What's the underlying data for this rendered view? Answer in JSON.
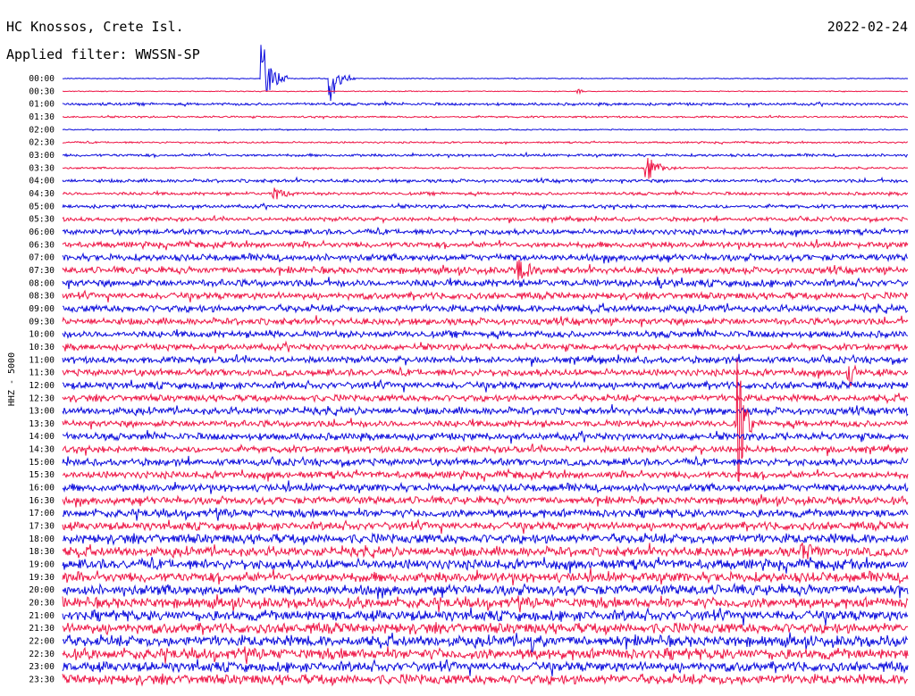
{
  "header": {
    "station": "HC Knossos, Crete Isl.",
    "filter": "Applied filter: WWSSN-SP",
    "date": "2022-02-24"
  },
  "chart_data": {
    "type": "line",
    "title": "HC Knossos, Crete Isl.",
    "subtitle": "Applied filter: WWSSN-SP",
    "date": "2022-02-24",
    "ylabel": "HHZ - 5000",
    "row_labels": [
      "00:00",
      "00:30",
      "01:00",
      "01:30",
      "02:00",
      "02:30",
      "03:00",
      "03:30",
      "04:00",
      "04:30",
      "05:00",
      "05:30",
      "06:00",
      "06:30",
      "07:00",
      "07:30",
      "08:00",
      "08:30",
      "09:00",
      "09:30",
      "10:00",
      "10:30",
      "11:00",
      "11:30",
      "12:00",
      "12:30",
      "13:00",
      "13:30",
      "14:00",
      "14:30",
      "15:00",
      "15:30",
      "16:00",
      "16:30",
      "17:00",
      "17:30",
      "18:00",
      "18:30",
      "19:00",
      "19:30",
      "20:00",
      "20:30",
      "21:00",
      "21:30",
      "22:00",
      "22:30",
      "23:00",
      "23:30"
    ],
    "trace_colors": [
      "#0b0bdc",
      "#ee1646"
    ],
    "noise_level": [
      0.4,
      0.4,
      1.2,
      0.8,
      0.5,
      0.8,
      1.2,
      0.8,
      1.5,
      1.4,
      1.6,
      1.8,
      2.4,
      2.6,
      3.0,
      3.0,
      3.2,
      3.0,
      3.2,
      3.0,
      3.0,
      2.8,
      3.0,
      3.0,
      3.2,
      3.0,
      3.2,
      3.0,
      3.2,
      3.0,
      3.2,
      3.2,
      3.4,
      3.4,
      3.6,
      3.6,
      4.2,
      4.2,
      4.4,
      4.4,
      4.6,
      4.6,
      4.6,
      4.6,
      4.8,
      4.8,
      4.4,
      4.4
    ],
    "events": [
      {
        "row": 0,
        "x": 0.236,
        "amplitude": 45,
        "duration": 0.03
      },
      {
        "row": 0,
        "x": 0.316,
        "amplitude": 30,
        "duration": 0.03
      },
      {
        "row": 1,
        "x": 0.61,
        "amplitude": 5,
        "duration": 0.01
      },
      {
        "row": 7,
        "x": 0.69,
        "amplitude": 16,
        "duration": 0.04
      },
      {
        "row": 9,
        "x": 0.25,
        "amplitude": 12,
        "duration": 0.03
      },
      {
        "row": 15,
        "x": 0.54,
        "amplitude": 14,
        "duration": 0.03
      },
      {
        "row": 16,
        "x": 0.705,
        "amplitude": 10,
        "duration": 0.02
      },
      {
        "row": 20,
        "x": 0.245,
        "amplitude": 8,
        "duration": 0.02
      },
      {
        "row": 23,
        "x": 0.93,
        "amplitude": 16,
        "duration": 0.03
      },
      {
        "row": 27,
        "x": 0.8,
        "amplitude": 75,
        "duration": 0.02
      },
      {
        "row": 37,
        "x": 0.875,
        "amplitude": 10,
        "duration": 0.03
      },
      {
        "row": 44,
        "x": 0.555,
        "amplitude": 14,
        "duration": 0.02
      }
    ]
  }
}
